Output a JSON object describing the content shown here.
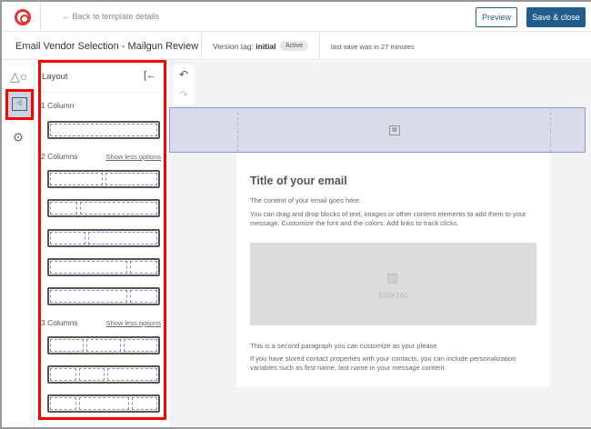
{
  "topbar": {
    "back_label": "← Back to template details",
    "preview_label": "Preview",
    "save_label": "Save & close"
  },
  "header": {
    "title": "Email Vendor Selection - Mailgun Review",
    "version_label": "Version tag:",
    "version_value": "initial",
    "status_badge": "Active",
    "last_save": "last save was in 27 minutes"
  },
  "rail": {
    "items": [
      {
        "icon": "shapes-icon"
      },
      {
        "icon": "layout-icon",
        "active": true
      },
      {
        "icon": "gear-icon"
      }
    ]
  },
  "layout_panel": {
    "title": "Layout",
    "sections": [
      {
        "label": "1 Column",
        "link": "",
        "rows": [
          [
            1
          ]
        ]
      },
      {
        "label": "2 Columns",
        "link": "Show less options",
        "rows": [
          [
            1,
            1
          ],
          [
            1,
            3
          ],
          [
            1,
            2
          ],
          [
            3,
            1
          ],
          [
            3,
            1
          ]
        ]
      },
      {
        "label": "3 Columns",
        "link": "Show less options",
        "rows": [
          [
            1,
            1,
            1
          ],
          [
            1,
            1,
            2
          ],
          [
            1,
            2,
            1
          ]
        ]
      }
    ]
  },
  "email": {
    "title": "Title of your email",
    "p1": "The content of your email goes here.",
    "p2": "You can drag and drop blocks of text, images or other content elements to add them to your message. Customize the font and the colors. Add links to track clicks.",
    "image_placeholder": "550X160",
    "p3": "This is a second paragraph you can customize as your please.",
    "p4": "If you have stored contact properties with your contacts, you can include personalization variables such as first name, last name in your message content."
  },
  "colors": {
    "accent": "#215d8c",
    "highlight": "#ff0000",
    "logo": "#e63232",
    "banner": "#d9dcea"
  }
}
